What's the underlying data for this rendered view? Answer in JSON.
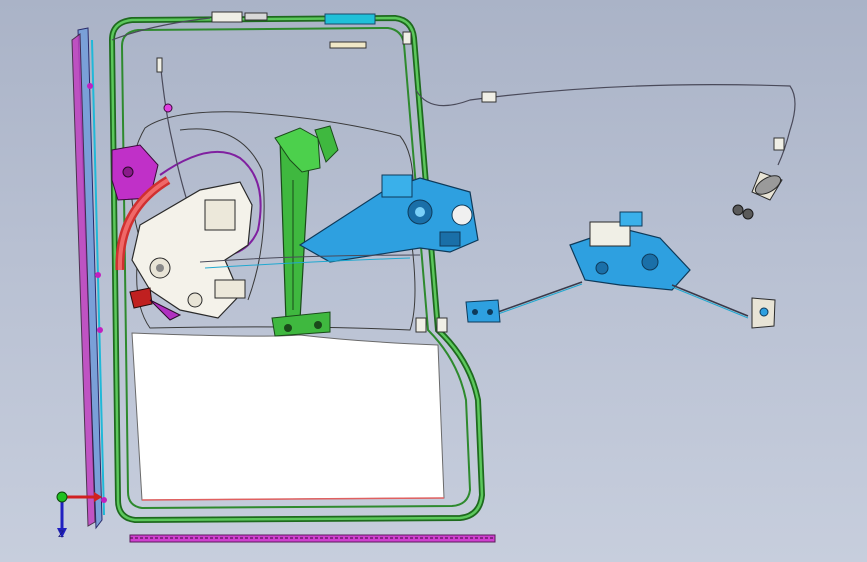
{
  "viewport": {
    "background_top": "#aab3c7",
    "background_bottom": "#c7cedd",
    "description_icon": "cad-assembly-view"
  },
  "colors": {
    "frame_green": "#2e8a2e",
    "frame_green_light": "#5cc85c",
    "regulator_green": "#3fb83f",
    "motor_blue": "#2ea0e0",
    "motor_blue_dark": "#1a6fa8",
    "lock_white": "#f4f2ea",
    "lock_outline": "#3a3a3a",
    "magenta": "#c020c0",
    "red": "#e03030",
    "cyan": "#20b8d8",
    "cable": "#4a4a5a",
    "glass": "#ffffff"
  },
  "triad": {
    "x_label": "",
    "y_label": "",
    "z_label": "Z"
  }
}
